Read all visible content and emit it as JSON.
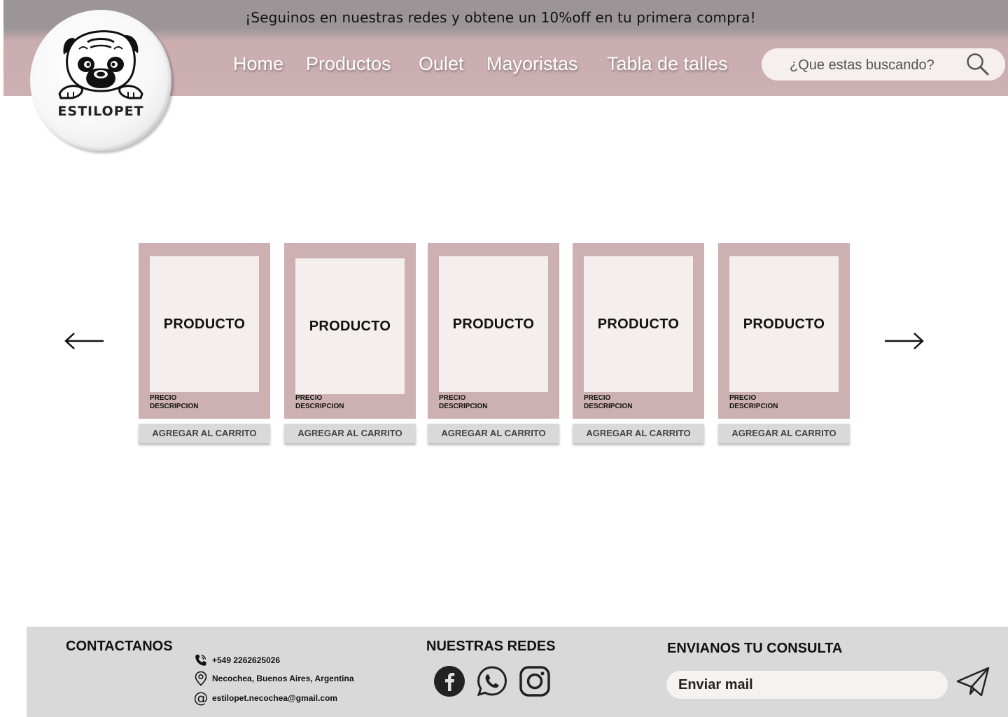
{
  "promo_text": "¡Seguinos en nuestras redes y obtene un 10%off en tu primera compra!",
  "brand": {
    "name": "ESTILOPET",
    "logo_icon": "pug-icon"
  },
  "nav": {
    "items": [
      {
        "label": "Home"
      },
      {
        "label": "Productos"
      },
      {
        "label": "Oulet"
      },
      {
        "label": "Mayoristas"
      },
      {
        "label": "Tabla de talles"
      }
    ]
  },
  "search": {
    "placeholder": "¿Que estas buscando?",
    "value": "",
    "icon": "search-icon"
  },
  "carousel": {
    "prev_icon": "arrow-left-icon",
    "next_icon": "arrow-right-icon",
    "products": [
      {
        "title": "PRODUCTO",
        "price": "PRECIO",
        "description": "DESCRIPCION",
        "button": "AGREGAR AL CARRITO"
      },
      {
        "title": "PRODUCTO",
        "price": "PRECIO",
        "description": "DESCRIPCION",
        "button": "AGREGAR AL CARRITO"
      },
      {
        "title": "PRODUCTO",
        "price": "PRECIO",
        "description": "DESCRIPCION",
        "button": "AGREGAR AL CARRITO"
      },
      {
        "title": "PRODUCTO",
        "price": "PRECIO",
        "description": "DESCRIPCION",
        "button": "AGREGAR AL CARRITO"
      },
      {
        "title": "PRODUCTO",
        "price": "PRECIO",
        "description": "DESCRIPCION",
        "button": "AGREGAR AL CARRITO"
      }
    ]
  },
  "footer": {
    "contact_title": "CONTACTANOS",
    "phone": "+549 2262625026",
    "address": "Necochea, Buenos Aires, Argentina",
    "email": "estilopet.necochea@gmail.com",
    "social_title": "NUESTRAS REDES",
    "social_icons": [
      "facebook-icon",
      "whatsapp-icon",
      "instagram-icon"
    ],
    "inquiry_title": "ENVIANOS TU CONSULTA",
    "mail_placeholder": "Enviar mail",
    "send_icon": "paper-plane-icon"
  },
  "colors": {
    "promo_bar": "#9c9597",
    "nav_bar": "#cdb0b3",
    "card": "#cdb0b2",
    "card_image": "#f4eeee",
    "footer": "#d9d9d9"
  }
}
